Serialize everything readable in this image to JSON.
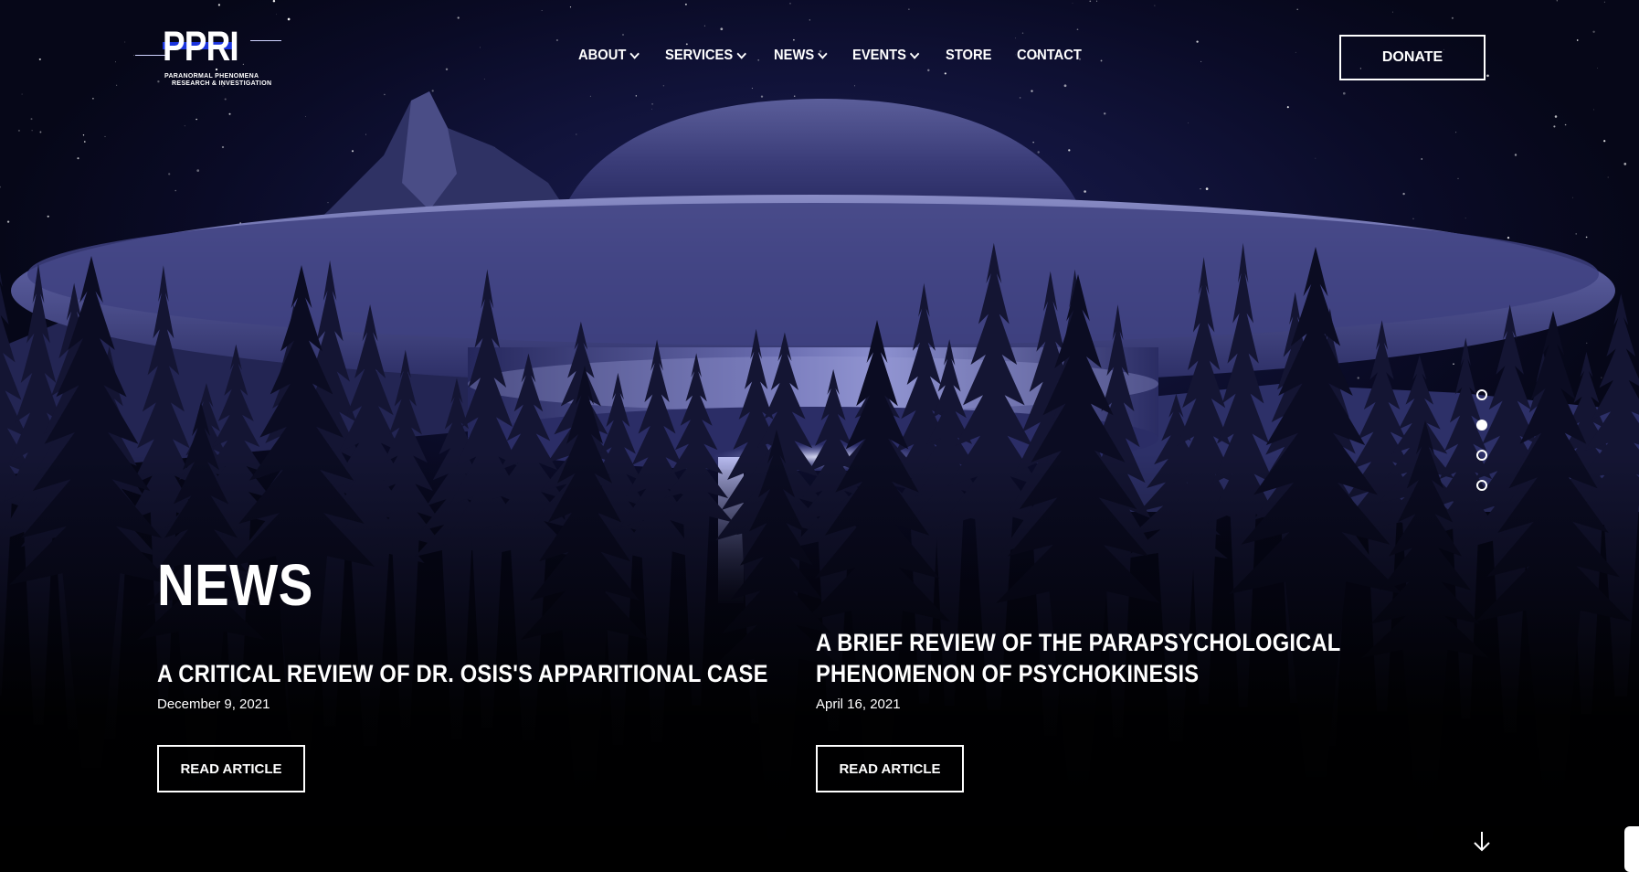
{
  "brand": {
    "logo_text": "PPRI",
    "tagline_line1": "PARANORMAL PHENOMENA",
    "tagline_line2": "RESEARCH & INVESTIGATION",
    "accent_blue": "#1f3cff"
  },
  "nav": {
    "items": [
      {
        "label": "ABOUT",
        "has_dropdown": true
      },
      {
        "label": "SERVICES",
        "has_dropdown": true
      },
      {
        "label": "NEWS",
        "has_dropdown": true
      },
      {
        "label": "EVENTS",
        "has_dropdown": true
      },
      {
        "label": "STORE",
        "has_dropdown": false
      },
      {
        "label": "CONTACT",
        "has_dropdown": false
      }
    ],
    "donate_label": "DONATE"
  },
  "hero": {
    "slides_count": 4,
    "active_slide": 2,
    "background_color": "#0b0c2a",
    "scroll_icon": "arrow-down-icon"
  },
  "news": {
    "title": "NEWS",
    "articles": [
      {
        "title": "A CRITICAL REVIEW OF DR. OSIS'S APPARITIONAL CASE",
        "date": "December 9, 2021",
        "button": "READ ARTICLE"
      },
      {
        "title": "A BRIEF REVIEW OF THE PARAPSYCHOLOGICAL PHENOMENON OF PSYCHOKINESIS",
        "date": "April 16, 2021",
        "button": "READ ARTICLE"
      }
    ]
  }
}
